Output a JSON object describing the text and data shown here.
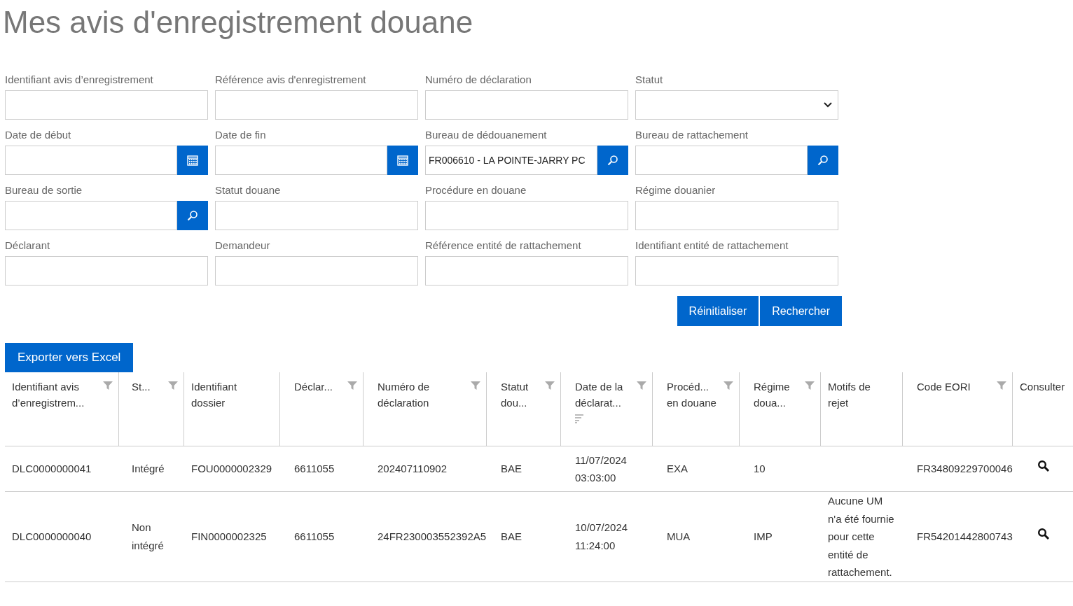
{
  "title": "Mes avis d'enregistrement douane",
  "filters": [
    {
      "label": "Identifiant avis d’enregistrement",
      "kind": "text"
    },
    {
      "label": "Référence avis d'enregistrement",
      "kind": "text"
    },
    {
      "label": "Numéro de déclaration",
      "kind": "text"
    },
    {
      "label": "Statut",
      "kind": "select"
    },
    {
      "label": "Date de début",
      "kind": "date"
    },
    {
      "label": "Date de fin",
      "kind": "date"
    },
    {
      "label": "Bureau de dédouanement",
      "kind": "lookup",
      "value": "FR006610 - LA POINTE-JARRY PC"
    },
    {
      "label": "Bureau de rattachement",
      "kind": "lookup"
    },
    {
      "label": "Bureau de sortie",
      "kind": "lookup"
    },
    {
      "label": "Statut douane",
      "kind": "text"
    },
    {
      "label": "Procédure en douane",
      "kind": "text"
    },
    {
      "label": "Régime douanier",
      "kind": "text"
    },
    {
      "label": "Déclarant",
      "kind": "text"
    },
    {
      "label": "Demandeur",
      "kind": "text"
    },
    {
      "label": "Référence entité de rattachement",
      "kind": "text"
    },
    {
      "label": "Identifiant entité de rattachement",
      "kind": "text"
    }
  ],
  "form_buttons": [
    "Réinitialiser",
    "Rechercher"
  ],
  "export_button": "Exporter vers Excel",
  "table": {
    "columns": [
      {
        "label": "Identifiant avis d’enregistrem...",
        "filter": true,
        "sort": false
      },
      {
        "label": "St...",
        "filter": true,
        "sort": false
      },
      {
        "label": "Identifiant dossier",
        "filter": false,
        "sort": false
      },
      {
        "label": "Déclar...",
        "filter": true,
        "sort": false
      },
      {
        "label": "Numéro de déclaration",
        "filter": true,
        "sort": false
      },
      {
        "label": "Statut dou...",
        "filter": true,
        "sort": false
      },
      {
        "label": "Date de la déclarat...",
        "filter": true,
        "sort": true
      },
      {
        "label": "Procéd... en douane",
        "filter": true,
        "sort": false
      },
      {
        "label": "Régime doua...",
        "filter": true,
        "sort": false
      },
      {
        "label": "Motifs de rejet",
        "filter": false,
        "sort": false
      },
      {
        "label": "Code EORI",
        "filter": true,
        "sort": false
      },
      {
        "label": "Consulter",
        "filter": false,
        "sort": false
      }
    ],
    "rows": [
      {
        "cells": [
          "DLC0000000041",
          "Intégré",
          "FOU0000002329",
          "6611055",
          "202407110902",
          "BAE",
          "11/07/2024 03:03:00",
          "EXA",
          "10",
          "",
          "FR34809229700046"
        ]
      },
      {
        "cells": [
          "DLC0000000040",
          "Non intégré",
          "FIN0000002325",
          "6611055",
          "24FR230003552392A5",
          "BAE",
          "10/07/2024 11:24:00",
          "MUA",
          "IMP",
          "Aucune UM n'a été fournie pour cette entité de rattachement.",
          "FR54201442800743"
        ]
      }
    ]
  }
}
